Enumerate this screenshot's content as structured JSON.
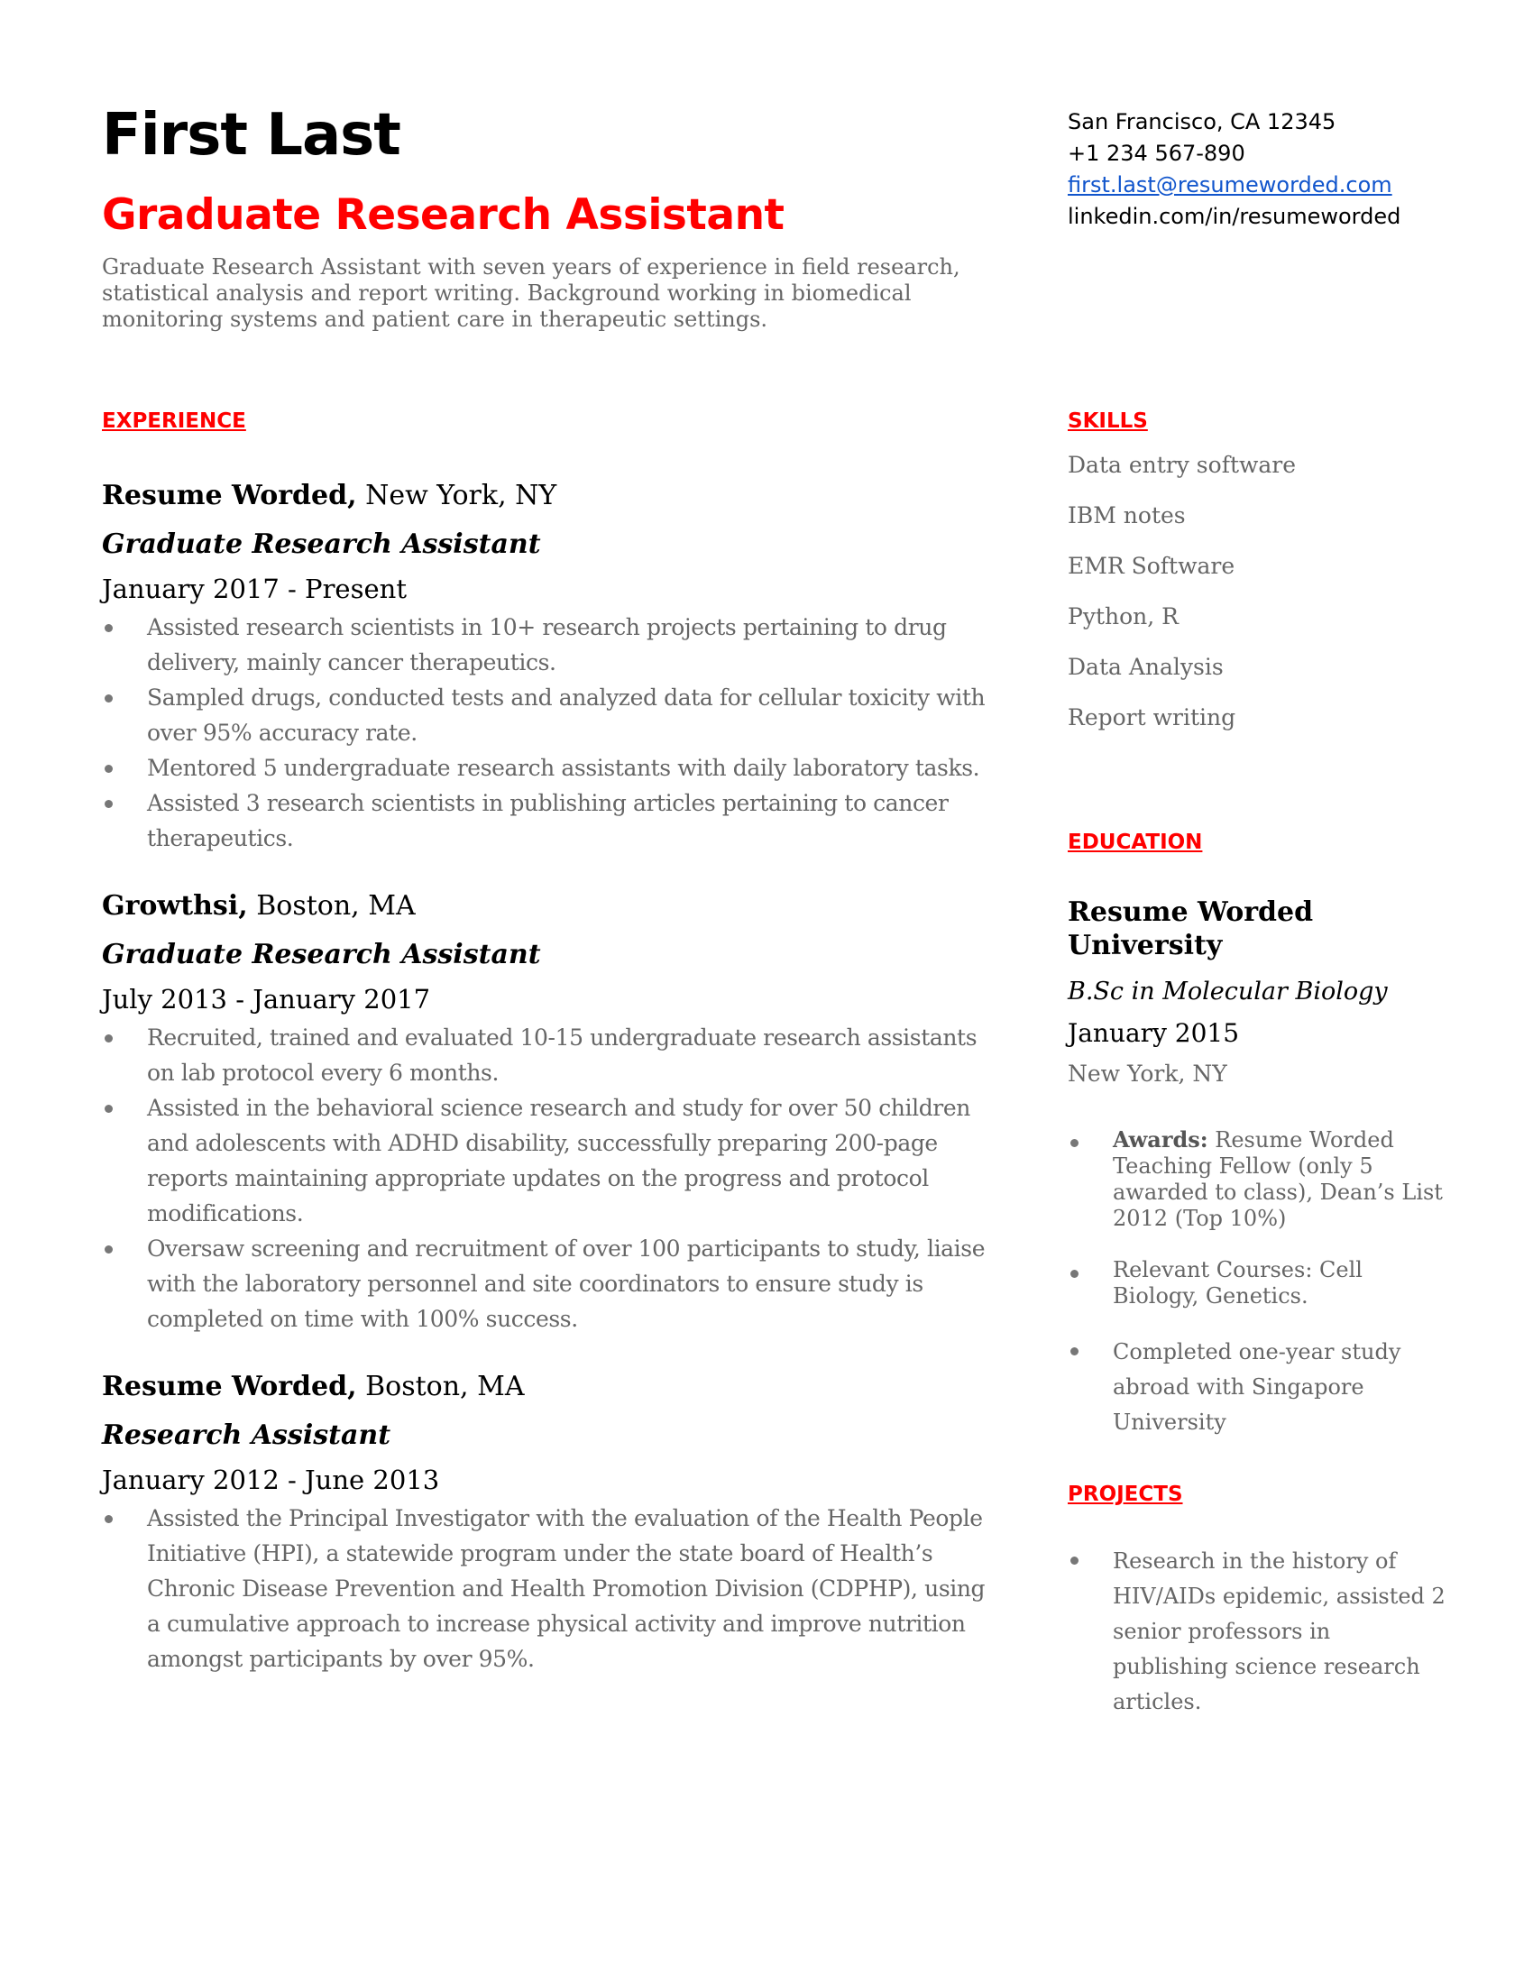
{
  "header": {
    "name": "First Last",
    "title": "Graduate Research Assistant",
    "summary": "Graduate Research Assistant  with seven  years of experience in field research, statistical analysis and report writing. Background working in biomedical monitoring systems and patient care in therapeutic settings."
  },
  "contact": {
    "location": "San Francisco, CA 12345",
    "phone": "+1 234 567-890",
    "email": "first.last@resumeworded.com",
    "linkedin": "linkedin.com/in/resumeworded"
  },
  "colors": {
    "accent": "#ff0000",
    "link": "#1155cc",
    "body_text": "#666666"
  },
  "experience": {
    "heading": "EXPERIENCE",
    "jobs": [
      {
        "company": "Resume Worded,",
        "location": " New York, NY",
        "role": "Graduate Research Assistant",
        "dates": "January 2017 - Present",
        "bullets": [
          "Assisted research scientists in 10+ research projects pertaining to drug delivery, mainly cancer therapeutics.",
          "Sampled drugs, conducted tests and analyzed data for cellular toxicity with over 95% accuracy rate.",
          "Mentored 5 undergraduate research assistants with daily laboratory tasks.",
          "Assisted 3 research scientists in publishing articles pertaining to cancer therapeutics."
        ]
      },
      {
        "company": "Growthsi,",
        "location": " Boston, MA",
        "role": "Graduate Research Assistant",
        "dates": "July 2013 - January 2017",
        "bullets": [
          "Recruited, trained and evaluated 10-15 undergraduate research assistants on lab protocol every 6 months.",
          "Assisted in the behavioral science research and study for over 50 children and adolescents with ADHD disability, successfully preparing 200-page reports maintaining appropriate updates on the progress and protocol modifications.",
          "Oversaw screening and recruitment of over 100 participants to study, liaise with the laboratory personnel and site coordinators to ensure study is completed on time with 100% success."
        ]
      },
      {
        "company": "Resume Worded,",
        "location": " Boston, MA",
        "role": "Research Assistant",
        "dates": "January 2012 - June 2013",
        "bullets": [
          "Assisted the Principal Investigator with the evaluation of the Health People Initiative (HPI), a statewide program under the state board of Health’s Chronic Disease Prevention and Health Promotion Division (CDPHP), using a cumulative approach to increase physical activity and improve nutrition amongst participants by over 95%."
        ]
      }
    ]
  },
  "skills": {
    "heading": "SKILLS",
    "items": [
      "Data entry software",
      "IBM notes",
      "EMR Software",
      "Python, R",
      "Data Analysis",
      "Report writing"
    ]
  },
  "education": {
    "heading": "EDUCATION",
    "school": "Resume Worded University",
    "degree": "B.Sc in Molecular Biology",
    "date": "January 2015",
    "location": "New York, NY",
    "bullets": [
      {
        "label": "Awards:",
        "text": " Resume Worded Teaching Fellow (only 5 awarded to class), Dean’s List 2012 (Top 10%)"
      },
      {
        "label": "",
        "text": "Relevant Courses: Cell Biology, Genetics."
      },
      {
        "label": "",
        "text": "Completed one-year study abroad with Singapore University"
      }
    ]
  },
  "projects": {
    "heading": "PROJECTS",
    "bullets": [
      "Research in the history of HIV/AIDs epidemic, assisted 2 senior professors in publishing science research articles."
    ]
  }
}
